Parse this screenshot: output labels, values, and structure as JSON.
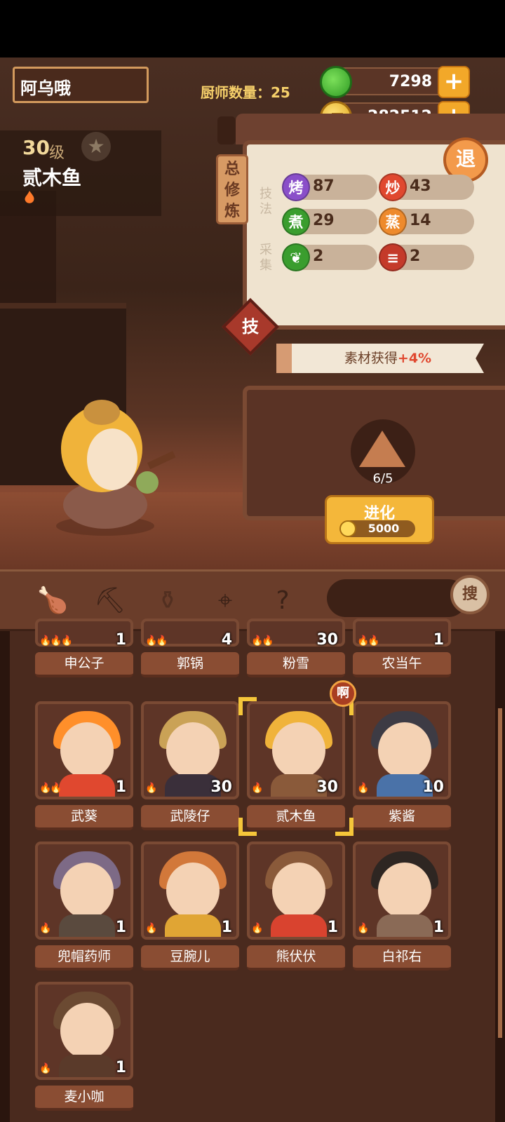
{
  "header": {
    "player_name": "阿乌哦",
    "chef_count_label": "厨师数量：",
    "chef_count_value": "25",
    "jade": "7298",
    "coins": "282512",
    "plus": "+"
  },
  "chef": {
    "level": "30",
    "level_unit": "级",
    "name": "贰木鱼"
  },
  "panel": {
    "tag": "总修炼",
    "exit": "退",
    "skills_label": "技法",
    "gather_label": "采集",
    "skills": [
      {
        "icon": "烤",
        "value": "87",
        "color": "#8a4fc9"
      },
      {
        "icon": "炒",
        "value": "43",
        "color": "#e0482f"
      },
      {
        "icon": "煮",
        "value": "29",
        "color": "#3a9d2e"
      },
      {
        "icon": "蒸",
        "value": "14",
        "color": "#ee8a2c"
      }
    ],
    "gather": [
      {
        "value": "2",
        "color": "#3a9d2e",
        "icon_name": "vegetable-icon"
      },
      {
        "value": "2",
        "color": "#c43a2a",
        "icon_name": "meat-icon"
      }
    ],
    "skill_button": "技",
    "bonus_text": "素材获得",
    "bonus_pct": "+4%",
    "fragment_count": "6/5",
    "evolve_label": "进化",
    "evolve_cost": "5000"
  },
  "toolbar": {
    "search_label": "搜"
  },
  "chefs": [
    {
      "name": "申公子",
      "level": "1",
      "flames": 3,
      "hair": "#8a8a8a",
      "body": "#4a7fa0"
    },
    {
      "name": "郭锅",
      "level": "4",
      "flames": 2,
      "hair": "#5a3a2a",
      "body": "#3a2a26"
    },
    {
      "name": "粉雪",
      "level": "30",
      "flames": 2,
      "hair": "#e06ab4",
      "body": "#f2a9d4"
    },
    {
      "name": "农当午",
      "level": "1",
      "flames": 2,
      "hair": "#8d6b4a",
      "body": "#7d5a3a"
    },
    {
      "name": "武葵",
      "level": "1",
      "flames": 2,
      "hair": "#ff8f2a",
      "body": "#e0482f"
    },
    {
      "name": "武陵仔",
      "level": "30",
      "flames": 1,
      "hair": "#caa256",
      "body": "#3a2f3a"
    },
    {
      "name": "贰木鱼",
      "level": "30",
      "flames": 1,
      "hair": "#f0b33a",
      "body": "#8a5a3a"
    },
    {
      "name": "紫酱",
      "level": "10",
      "flames": 1,
      "hair": "#3d3b44",
      "body": "#4a72a8"
    },
    {
      "name": "兜帽药师",
      "level": "1",
      "flames": 1,
      "hair": "#7d6a86",
      "body": "#5a4a3e"
    },
    {
      "name": "豆腕儿",
      "level": "1",
      "flames": 1,
      "hair": "#d2783a",
      "body": "#e0a534"
    },
    {
      "name": "熊伏伏",
      "level": "1",
      "flames": 1,
      "hair": "#8a5a3a",
      "body": "#d9432f"
    },
    {
      "name": "白祁右",
      "level": "1",
      "flames": 1,
      "hair": "#2e2622",
      "body": "#8a6a56"
    },
    {
      "name": "麦小咖",
      "level": "1",
      "flames": 1,
      "hair": "#6b4a32",
      "body": "#5a3a2a"
    }
  ],
  "new_badge": "啊"
}
